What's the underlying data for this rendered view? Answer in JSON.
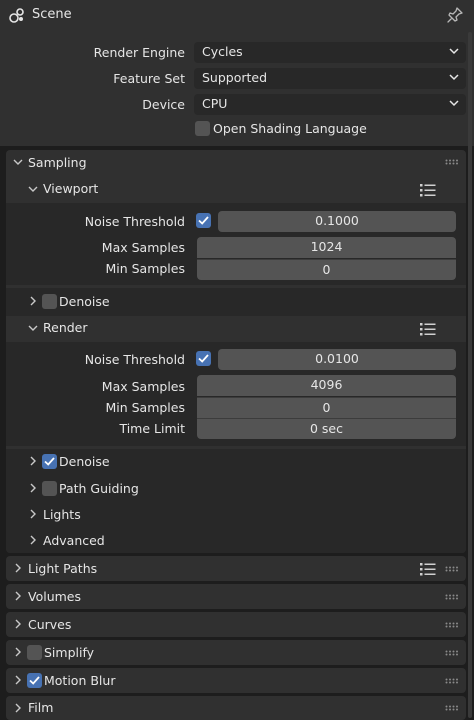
{
  "header": {
    "title": "Scene"
  },
  "top": {
    "render_engine_label": "Render Engine",
    "render_engine_value": "Cycles",
    "feature_set_label": "Feature Set",
    "feature_set_value": "Supported",
    "device_label": "Device",
    "device_value": "CPU",
    "osl_label": "Open Shading Language",
    "osl_checked": false
  },
  "sampling": {
    "title": "Sampling",
    "viewport": {
      "title": "Viewport",
      "noise_threshold_label": "Noise Threshold",
      "noise_threshold_value": "0.1000",
      "noise_threshold_enabled": true,
      "max_samples_label": "Max Samples",
      "max_samples_value": "1024",
      "min_samples_label": "Min Samples",
      "min_samples_value": "0",
      "denoise_label": "Denoise",
      "denoise_checked": false
    },
    "render": {
      "title": "Render",
      "noise_threshold_label": "Noise Threshold",
      "noise_threshold_value": "0.0100",
      "noise_threshold_enabled": true,
      "max_samples_label": "Max Samples",
      "max_samples_value": "4096",
      "min_samples_label": "Min Samples",
      "min_samples_value": "0",
      "time_limit_label": "Time Limit",
      "time_limit_value": "0 sec",
      "denoise_label": "Denoise",
      "denoise_checked": true
    },
    "path_guiding_label": "Path Guiding",
    "path_guiding_checked": false,
    "lights_label": "Lights",
    "advanced_label": "Advanced"
  },
  "panels": {
    "light_paths": "Light Paths",
    "volumes": "Volumes",
    "curves": "Curves",
    "simplify": "Simplify",
    "simplify_checked": false,
    "motion_blur": "Motion Blur",
    "motion_blur_checked": true,
    "film": "Film"
  },
  "colors": {
    "accent": "#4772b3",
    "panel": "#303030",
    "subpanel": "#282828",
    "field": "#545454",
    "background": "#1d1d1d"
  }
}
